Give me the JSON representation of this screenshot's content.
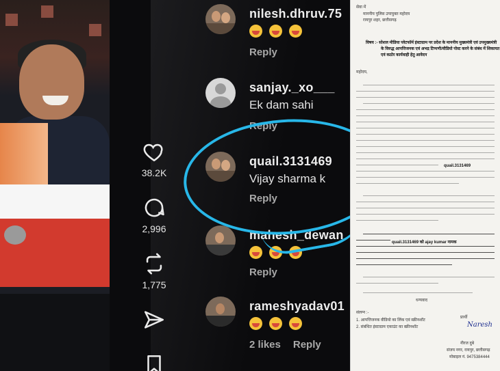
{
  "phone": {
    "actions": {
      "likes_count": "38.2K",
      "comments_count": "2,996",
      "reposts_count": "1,775"
    },
    "comments": [
      {
        "username": "nilesh.dhruv.75",
        "text": "",
        "emoji_count": 3,
        "reply_label": "Reply"
      },
      {
        "username": "sanjay._xo___",
        "text": "Ek dam sahi",
        "emoji_count": 0,
        "reply_label": "Reply"
      },
      {
        "username": "quail.3131469",
        "text": "Vijay sharma k",
        "emoji_count": 0,
        "reply_label": "Reply"
      },
      {
        "username": "mahesh_dewan",
        "text": "",
        "emoji_count": 3,
        "reply_label": "Reply"
      },
      {
        "username": "rameshyadav01",
        "text": "",
        "emoji_count": 3,
        "reply_label": "Reply",
        "likes_label": "2 likes"
      }
    ],
    "highlight_color": "#28b7e8"
  },
  "document": {
    "line1": "सेवा में",
    "line2": "माननीय पुलिस उपायुक्त महोदय",
    "line3": "रायपुर शहर, छत्तीसगढ़",
    "subject": "विषय :- सोशल मीडिया प्लेटफॉर्म इंस्टाग्राम पर प्रदेश के माननीय मुख्यमंत्री एवं उपमुख्यमंत्री",
    "subject2": "के विरुद्ध आपत्तिजनक एवं अभद्र टिप्पणी/वीडियो पोस्ट करने के संबंध में शिकायत",
    "subject3": "एवं कठोर कार्यवाही हेतु आवेदन",
    "salutation": "महोदय,",
    "handle_highlight": "quail.3131469",
    "handle_highlight2": "quail.3131469 को ajay kumar नामक",
    "enclosure": "संलग्न :-",
    "enc1": "1. आपत्तिजनक वीडियो का लिंक एवं स्क्रीनशॉट",
    "enc2": "2. संबंधित इंस्टाग्राम एकाउंट का स्क्रीनशॉट",
    "applicant_label": "प्रार्थी",
    "signature": "Naresh",
    "name": "नीरज दुबे",
    "address": "संजय नगर, रायपुर, छत्तीसगढ़",
    "mobile": "मोबाइल नं. 9475384444",
    "closing": "धन्यवाद"
  }
}
